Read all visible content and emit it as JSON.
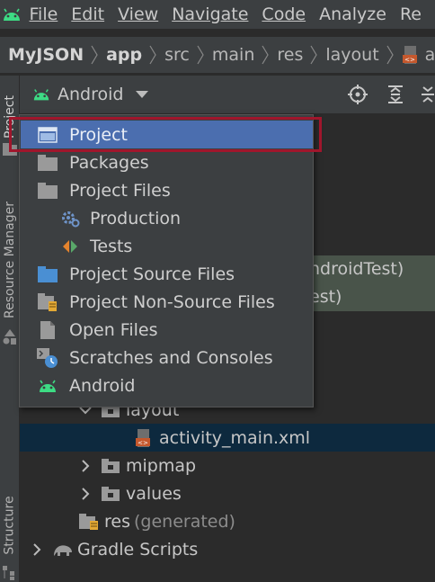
{
  "menubar": {
    "items": [
      "File",
      "Edit",
      "View",
      "Navigate",
      "Code",
      "Analyze",
      "Re"
    ]
  },
  "breadcrumb": {
    "items": [
      "MyJSON",
      "app",
      "src",
      "main",
      "res",
      "layout",
      "a"
    ]
  },
  "toolstrip": {
    "project": "Project",
    "resource_manager": "Resource Manager",
    "structure": "Structure"
  },
  "panel": {
    "view_selector": "Android"
  },
  "popup": {
    "items": [
      {
        "label": "Project",
        "icon": "project-window-icon"
      },
      {
        "label": "Packages",
        "icon": "folder-icon"
      },
      {
        "label": "Project Files",
        "icon": "folder-icon"
      },
      {
        "label": "Production",
        "icon": "gear-icon"
      },
      {
        "label": "Tests",
        "icon": "tests-arrows-icon"
      },
      {
        "label": "Project Source Files",
        "icon": "blue-folder-icon"
      },
      {
        "label": "Project Non-Source Files",
        "icon": "folder-file-icon"
      },
      {
        "label": "Open Files",
        "icon": "file-icon"
      },
      {
        "label": "Scratches and Consoles",
        "icon": "scratches-icon"
      },
      {
        "label": "Android",
        "icon": "android-icon"
      }
    ]
  },
  "tree": {
    "partial_rows": [
      "ndroidTest)",
      "est)"
    ],
    "rows": [
      {
        "label": "layout"
      },
      {
        "label": "activity_main.xml"
      },
      {
        "label": "mipmap"
      },
      {
        "label": "values"
      },
      {
        "label": "res",
        "note": "(generated)"
      },
      {
        "label": "Gradle Scripts"
      }
    ]
  }
}
